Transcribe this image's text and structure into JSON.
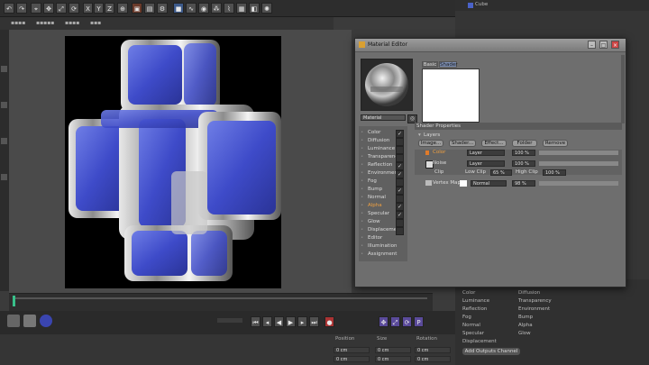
{
  "toolbar": {
    "x": "X",
    "y": "Y",
    "z": "Z"
  },
  "object_manager": {
    "selected_object": "Cube"
  },
  "material_editor": {
    "title": "Material Editor",
    "tabs": [
      "Basic",
      "Shader"
    ],
    "material_name": "Material",
    "channels": [
      {
        "label": "Color",
        "checked": true
      },
      {
        "label": "Diffusion",
        "checked": false
      },
      {
        "label": "Luminance",
        "checked": false
      },
      {
        "label": "Transparency",
        "checked": false
      },
      {
        "label": "Reflection",
        "checked": true
      },
      {
        "label": "Environment",
        "checked": true
      },
      {
        "label": "Fog",
        "checked": false
      },
      {
        "label": "Bump",
        "checked": true
      },
      {
        "label": "Normal",
        "checked": false
      },
      {
        "label": "Alpha",
        "checked": true
      },
      {
        "label": "Specular",
        "checked": true
      },
      {
        "label": "Glow",
        "checked": false
      },
      {
        "label": "Displacement",
        "checked": false
      },
      {
        "label": "Editor",
        "checked": null
      },
      {
        "label": "Illumination",
        "checked": null
      },
      {
        "label": "Assignment",
        "checked": null
      }
    ],
    "section_title": "Shader Properties",
    "layers_label": "Layers",
    "layer_buttons": [
      "Image...",
      "Shader...",
      "Effect...",
      "Folder",
      "Remove"
    ],
    "rows": {
      "color": {
        "label": "Color",
        "mode": "Layer",
        "value": "100 %"
      },
      "noise": {
        "label": "Noise",
        "mode": "Layer",
        "value": "100 %"
      },
      "clip": {
        "label": "Clip",
        "low_label": "Low Clip",
        "low_value": "65 %",
        "high_label": "High Clip",
        "high_value": "100 %"
      },
      "vertex": {
        "label": "Vertex Map",
        "mode": "Normal",
        "value": "98 %"
      }
    }
  },
  "attributes_panel": {
    "left_col": [
      "Color",
      "Luminance",
      "Reflection",
      "Fog",
      "Normal",
      "Specular",
      "Displacement"
    ],
    "right_col": [
      "Diffusion",
      "Transparency",
      "Environment",
      "Bump",
      "Alpha",
      "Glow"
    ],
    "button": "Add Outputs Channel"
  },
  "coordinates": {
    "headers": [
      "Position",
      "Size",
      "Rotation"
    ],
    "values": [
      "0 cm",
      "0 cm",
      "0 cm"
    ]
  }
}
